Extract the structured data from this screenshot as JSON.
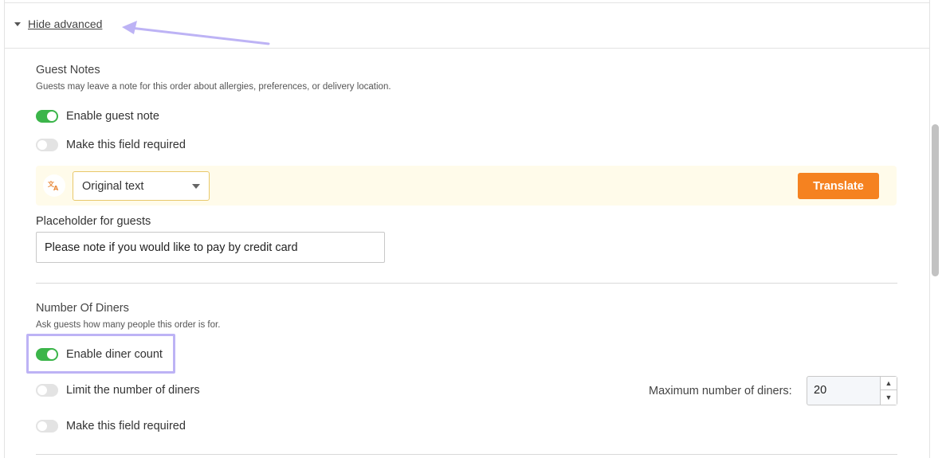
{
  "advanced": {
    "label": "Hide advanced"
  },
  "guest_notes": {
    "title": "Guest Notes",
    "description": "Guests may leave a note for this order about allergies, preferences, or delivery location.",
    "enable_label": "Enable guest note",
    "enable_on": true,
    "required_label": "Make this field required",
    "required_on": false,
    "translate": {
      "icon": "translate-icon",
      "language_value": "Original text",
      "button_label": "Translate"
    },
    "placeholder": {
      "label": "Placeholder for guests",
      "value": "Please note if you would like to pay by credit card"
    }
  },
  "diners": {
    "title": "Number Of Diners",
    "description": "Ask guests how many people this order is for.",
    "enable_label": "Enable diner count",
    "enable_on": true,
    "limit_label": "Limit the number of diners",
    "limit_on": false,
    "max_label": "Maximum number of diners:",
    "max_value": "20",
    "required_label": "Make this field required",
    "required_on": false
  },
  "colors": {
    "toggle_on": "#3bb54a",
    "toggle_off": "#e3e3e3",
    "accent_button": "#f58220",
    "translate_bar": "#fffbea",
    "annotation": "#bdb3f5"
  }
}
